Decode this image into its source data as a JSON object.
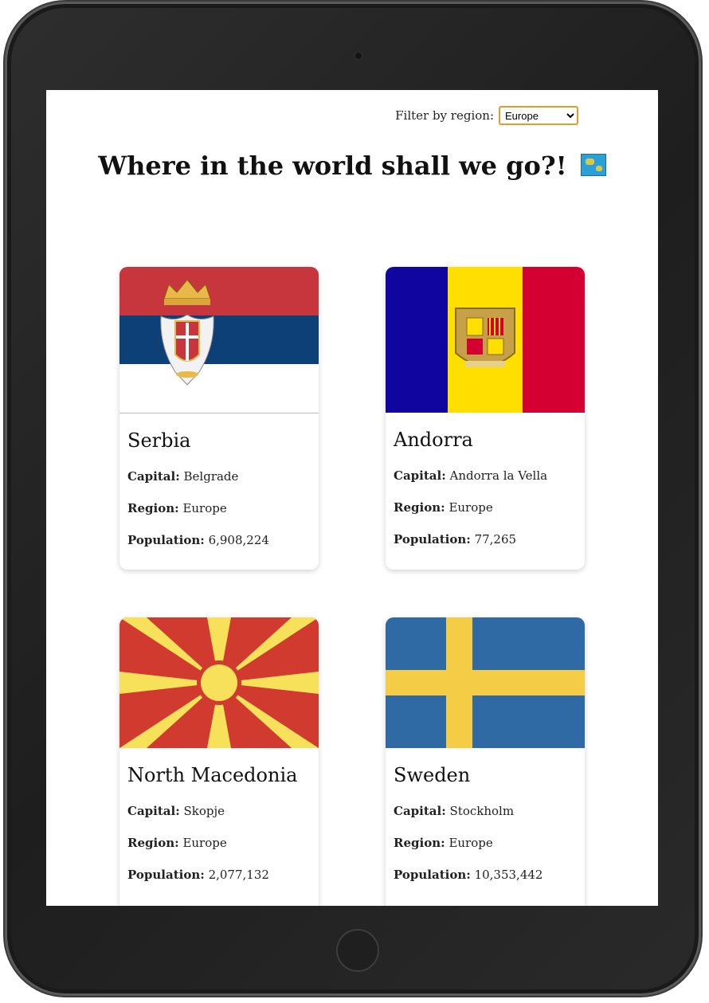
{
  "filter": {
    "label": "Filter by region:",
    "selected": "Europe",
    "options": [
      "Europe"
    ]
  },
  "heading": "Where in the world shall we go?!",
  "heading_emoji": "world-map-icon",
  "labels": {
    "capital": "Capital:",
    "region": "Region:",
    "population": "Population:"
  },
  "countries": [
    {
      "name": "Serbia",
      "capital": "Belgrade",
      "region": "Europe",
      "population": "6,908,224",
      "flag": "serbia-flag"
    },
    {
      "name": "Andorra",
      "capital": "Andorra la Vella",
      "region": "Europe",
      "population": "77,265",
      "flag": "andorra-flag"
    },
    {
      "name": "North Macedonia",
      "capital": "Skopje",
      "region": "Europe",
      "population": "2,077,132",
      "flag": "north-macedonia-flag"
    },
    {
      "name": "Sweden",
      "capital": "Stockholm",
      "region": "Europe",
      "population": "10,353,442",
      "flag": "sweden-flag"
    }
  ],
  "colors": {
    "select_border": "#e39b2e",
    "serbia": [
      "#c6363c",
      "#0c4076",
      "#ffffff"
    ],
    "andorra": [
      "#10069f",
      "#fedf00",
      "#d50032"
    ],
    "north_macedonia": [
      "#d20000",
      "#ffe600"
    ],
    "sweden": [
      "#006aa7",
      "#fecc00"
    ]
  }
}
